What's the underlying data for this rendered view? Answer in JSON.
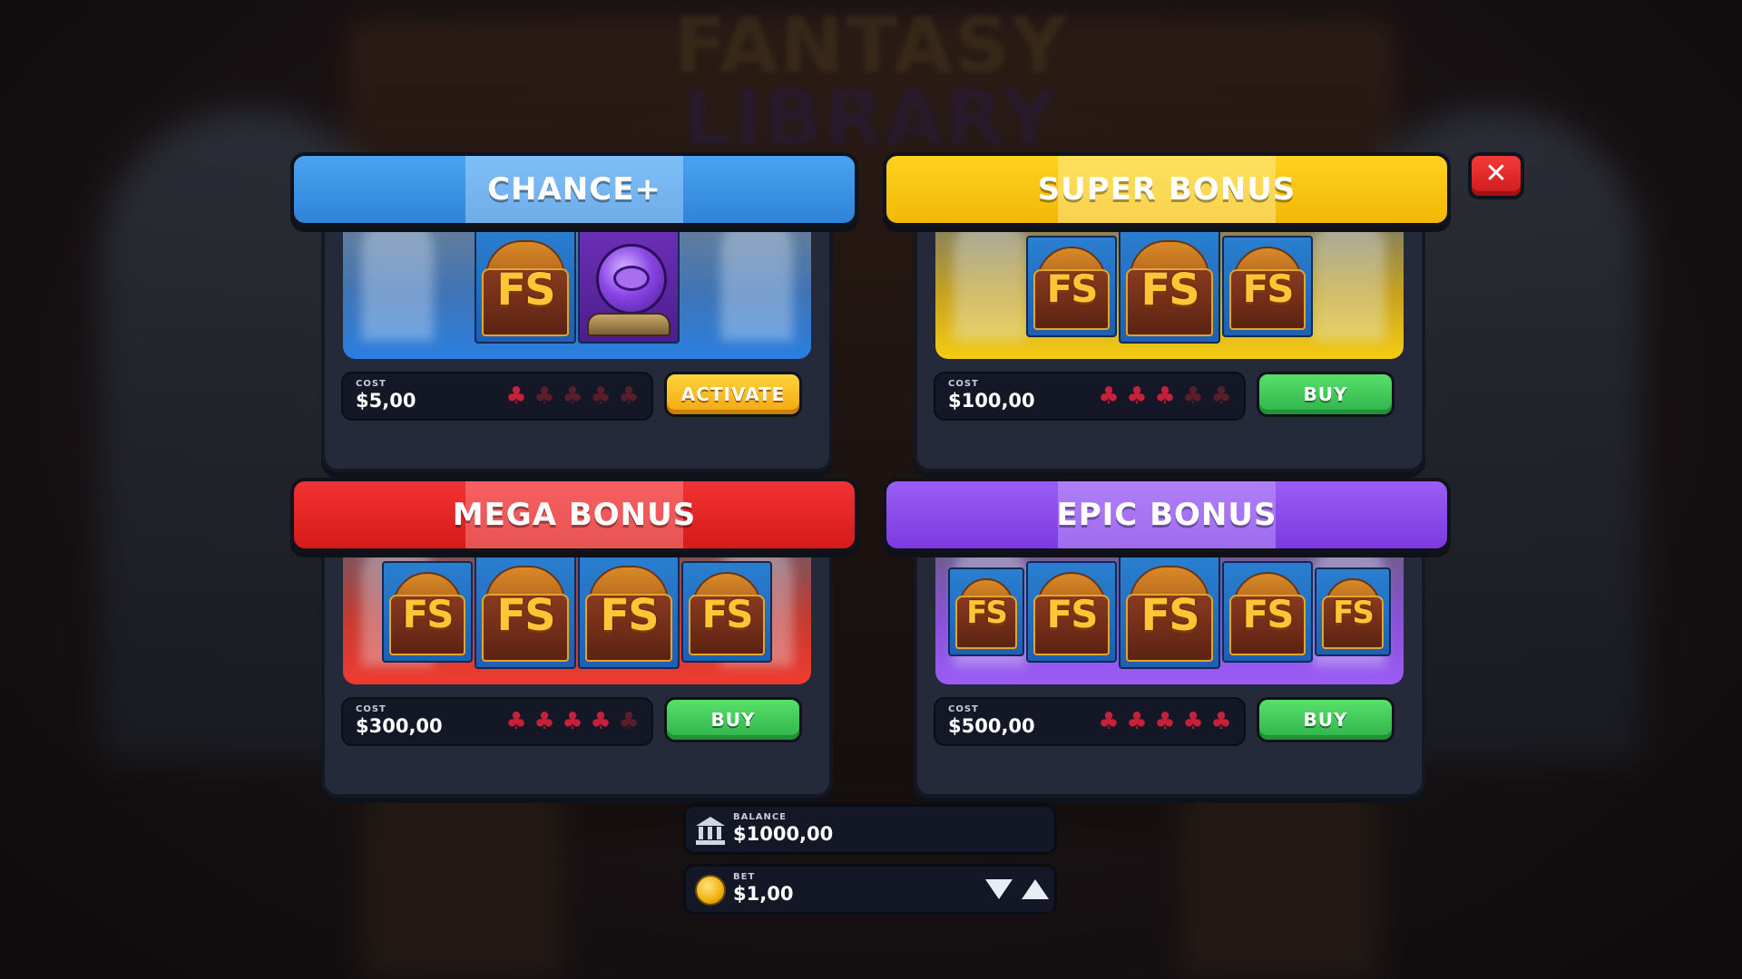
{
  "background": {
    "logo_line1": "FANTASY",
    "logo_line2": "LIBRARY"
  },
  "cards": [
    {
      "title": "CHANCE+",
      "cost_label": "COST",
      "cost": "$5,00",
      "action": "ACTIVATE",
      "level": 1,
      "max_level": 5
    },
    {
      "title": "SUPER BONUS",
      "cost_label": "COST",
      "cost": "$100,00",
      "action": "BUY",
      "level": 3,
      "max_level": 5
    },
    {
      "title": "MEGA BONUS",
      "cost_label": "COST",
      "cost": "$300,00",
      "action": "BUY",
      "level": 4,
      "max_level": 5
    },
    {
      "title": "EPIC BONUS",
      "cost_label": "COST",
      "cost": "$500,00",
      "action": "BUY",
      "level": 5,
      "max_level": 5
    }
  ],
  "tile_text": "FS",
  "chance_plus_sign": "+",
  "close_button": {
    "icon": "close-icon",
    "glyph": "✕"
  },
  "balance": {
    "label": "BALANCE",
    "value": "$1000,00",
    "icon": "bank-icon"
  },
  "bet": {
    "label": "BET",
    "value": "$1,00",
    "icon": "coin-icon"
  },
  "colors": {
    "blue": "#2f83d8",
    "yellow": "#f2b707",
    "red": "#d41a1a",
    "purple": "#7b3ae0",
    "buy_green": "#2db24a",
    "activate_yellow": "#f2a612",
    "clover_on": "#c8203a",
    "clover_off": "#5a1e2a"
  }
}
